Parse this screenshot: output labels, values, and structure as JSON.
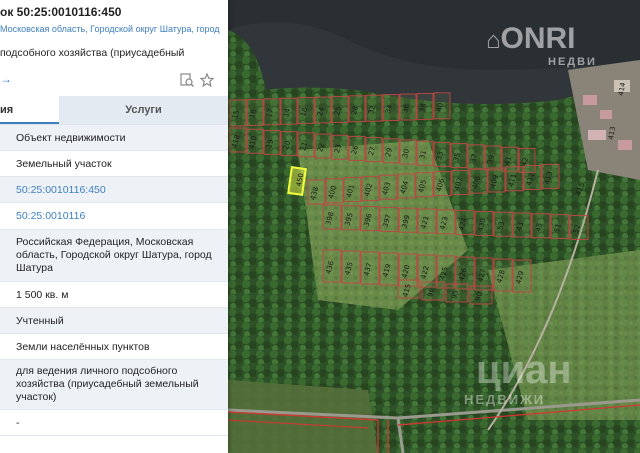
{
  "panel": {
    "title": "ок 50:25:0010116:450",
    "subtitle": "Московская область, Городской округ Шатура, город",
    "type_text": "подсобного хозяйства (приусадебный",
    "arrow_text": "→",
    "tabs": [
      {
        "label": "ия"
      },
      {
        "label": "Услуги"
      }
    ],
    "rows": [
      {
        "text": "Объект недвижимости"
      },
      {
        "text": "Земельный участок"
      },
      {
        "text": "50:25:0010116:450"
      },
      {
        "text": "50:25:0010116"
      },
      {
        "text": "Российская Федерация, Московская область, Городской округ Шатура, город Шатура"
      },
      {
        "text": "1 500 кв. м"
      },
      {
        "text": "Учтенный"
      },
      {
        "text": "Земли населённых пунктов"
      },
      {
        "text": "для ведения личного подсобного хозяйства (приусадебный земельный участок)"
      },
      {
        "text": "-"
      }
    ]
  },
  "map": {
    "watermark_top": "ONRI",
    "watermark_top_sub": "НЕДВИ",
    "watermark_bottom": "циан",
    "watermark_bottom_sub": "НЕДВИЖИ",
    "top_row": [
      "15",
      "16",
      "17",
      "14",
      "18",
      "24",
      "25",
      "28",
      "32",
      "34",
      "36",
      "38",
      "40"
    ],
    "row2": [
      "418",
      "410",
      "19",
      "20",
      "21",
      "22",
      "23",
      "26",
      "27",
      "29",
      "30",
      "31",
      "33",
      "35",
      "37",
      "39",
      "41",
      "42"
    ],
    "row3": [
      "438",
      "400",
      "401",
      "402",
      "403",
      "404",
      "405",
      "406",
      "407",
      "408",
      "409",
      "411",
      "412",
      "413"
    ],
    "row4": [
      "398",
      "395",
      "396",
      "397",
      "399",
      "421",
      "423",
      "424",
      "430",
      "53",
      "43",
      "45",
      "51",
      "52"
    ],
    "row5": [
      "436",
      "435",
      "437",
      "419",
      "420",
      "422",
      "425",
      "426",
      "427",
      "428",
      "429"
    ],
    "row6": [
      "415",
      "96",
      "95",
      "90"
    ],
    "right_labels": [
      "414",
      "413",
      "415"
    ],
    "highlight_label": "450"
  }
}
